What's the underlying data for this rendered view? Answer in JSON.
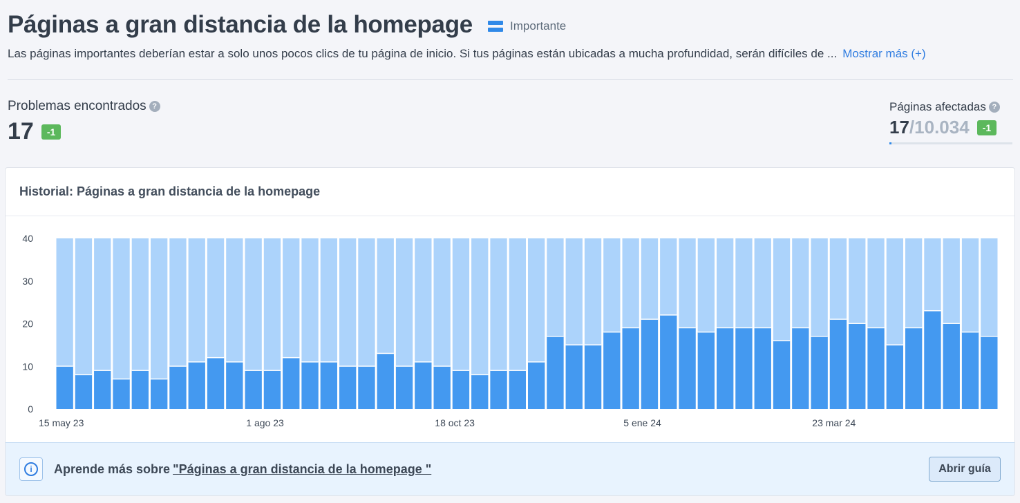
{
  "header": {
    "title": "Páginas a gran distancia de la homepage",
    "severity_label": "Importante",
    "severity_icon": "priority-bars-icon",
    "description": "Las páginas importantes deberían estar a solo unos pocos clics de tu página de inicio. Si tus páginas están ubicadas a mucha profundidad, serán difíciles de ...",
    "show_more": "Mostrar más (+)"
  },
  "metrics": {
    "issues": {
      "label": "Problemas encontrados",
      "value": "17",
      "delta": "-1"
    },
    "affected": {
      "label": "Páginas afectadas",
      "value": "17",
      "total": "/10.034",
      "delta": "-1",
      "fraction": 0.0017
    }
  },
  "card": {
    "title": "Historial: Páginas a gran distancia de la homepage",
    "footer_prefix": "Aprende más sobre",
    "footer_link": "\"Páginas a gran distancia de la homepage \"",
    "guide_button": "Abrir guía"
  },
  "colors": {
    "bar_primary": "#4499f0",
    "bar_background": "#acd3fb",
    "accent": "#2f7ce0",
    "badge": "#5cb85c"
  },
  "chart_data": {
    "type": "bar",
    "stacked_background_total": 40,
    "ylim": [
      0,
      40
    ],
    "y_ticks": [
      0,
      10,
      20,
      30,
      40
    ],
    "x_tick_labels": [
      {
        "index": 0,
        "label": "15 may 23"
      },
      {
        "index": 11,
        "label": "1 ago 23"
      },
      {
        "index": 21,
        "label": "18 oct 23"
      },
      {
        "index": 31,
        "label": "5 ene 24"
      },
      {
        "index": 41,
        "label": "23 mar 24"
      }
    ],
    "values": [
      10,
      8,
      9,
      7,
      9,
      7,
      10,
      11,
      12,
      11,
      9,
      9,
      12,
      11,
      11,
      10,
      10,
      13,
      10,
      11,
      10,
      9,
      8,
      9,
      9,
      11,
      17,
      15,
      15,
      18,
      19,
      21,
      22,
      19,
      18,
      19,
      19,
      19,
      16,
      19,
      17,
      21,
      20,
      19,
      15,
      19,
      23,
      20,
      18,
      17
    ]
  }
}
